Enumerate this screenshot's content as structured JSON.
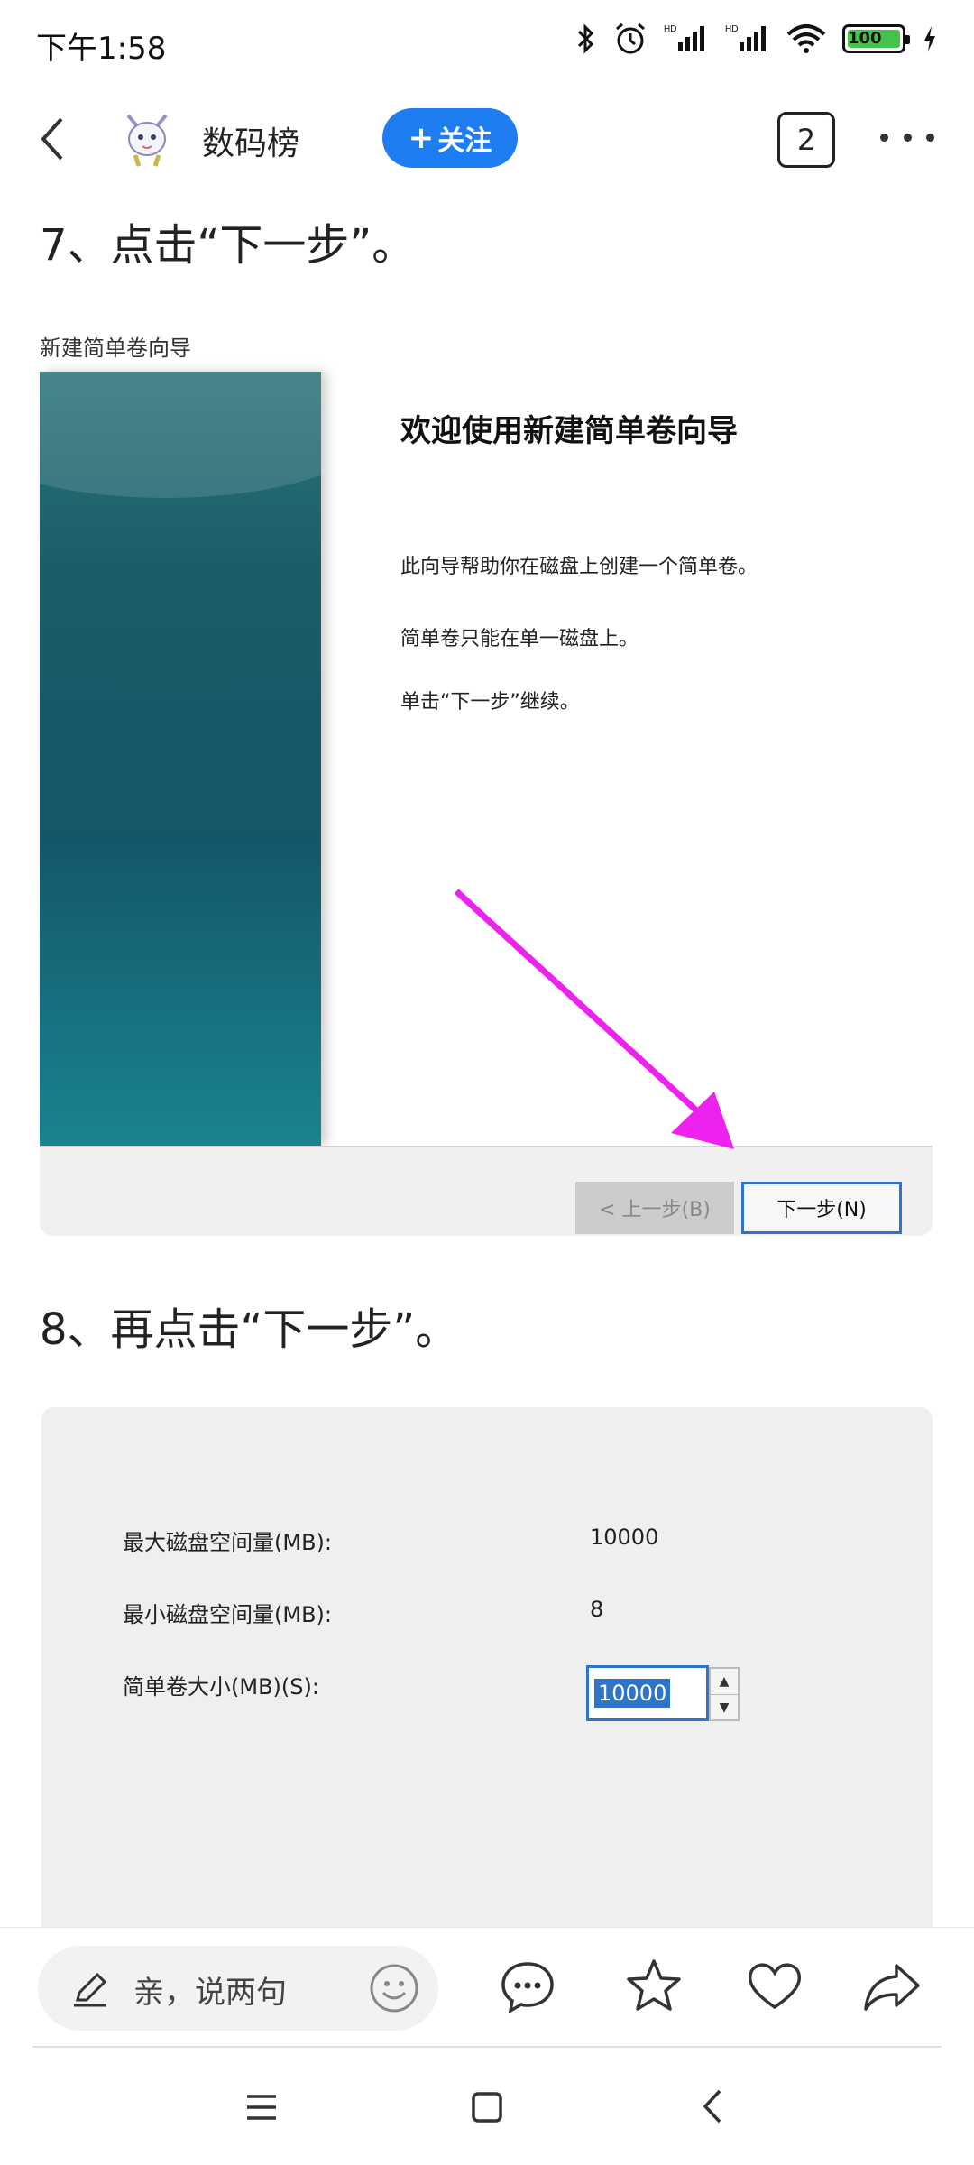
{
  "status_bar": {
    "time": "下午1:58",
    "hd1": "HD",
    "hd2": "HD",
    "battery": "100"
  },
  "header": {
    "channel_name": "数码榜",
    "follow_label": "关注",
    "follow_plus": "+",
    "count": "2"
  },
  "article": {
    "step7": "7、点击“下一步”。",
    "step8": "8、再点击“下一步”。",
    "wizard": {
      "window_title": "新建简单卷向导",
      "heading": "欢迎使用新建简单卷向导",
      "lines": [
        "此向导帮助你在磁盘上创建一个简单卷。",
        "简单卷只能在单一磁盘上。",
        "单击“下一步”继续。"
      ],
      "prev_button": "< 上一步(B)",
      "next_button": "下一步(N)"
    },
    "size_panel": {
      "max_label": "最大磁盘空间量(MB):",
      "max_value": "10000",
      "min_label": "最小磁盘空间量(MB):",
      "min_value": "8",
      "size_label": "简单卷大小(MB)(S):",
      "size_value": "10000"
    }
  },
  "bottom_bar": {
    "comment_placeholder": "亲，说两句"
  },
  "colors": {
    "accent": "#1e7df0",
    "arrow": "#ee22ee",
    "wizard_teal": "#135769"
  }
}
